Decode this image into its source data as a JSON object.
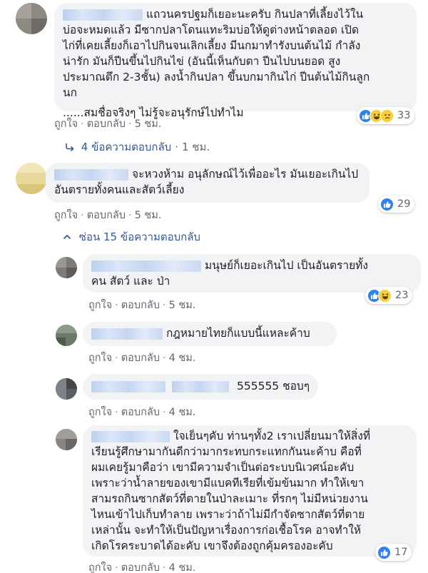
{
  "labels": {
    "like": "ถูกใจ",
    "reply": "ตอบกลับ",
    "dot": "·"
  },
  "comments": [
    {
      "author": "Jan Doe",
      "lines": [
        "แถวนครปฐมก็เยอะนะครับ กินปลาที่เลี้ยงไว้ใน",
        "บ่อจะหมดแล้ว มีซากปลาโดนแทะริมบ่อให้ดูต่างหน้าตลอด เปิด",
        "ไก่ที่เคยเลี้ยงก็เอาไปกินจนเลิกเลี้ยง มีนกมาทำรังบนต้นไม้ กำลัง",
        "น่ารัก มันก็ปีนขึ้นไปกินไข่ (อันนี้เห็นกับตา ปีนไปบนยอด สูง",
        "ประมาณตึก 2-3ชั้น) ลงน้ำกินปลา ขึ้นบกมากินไก่ ปีนต้นไม้กินลูก",
        "นก",
        "",
        "......สมชื่อจริงๆ ไม่รู้จะอนุรักษ์ไปทำไม"
      ],
      "reactions": {
        "icons": [
          "like",
          "haha",
          "sad"
        ],
        "count": "33"
      },
      "time": "5 ชม.",
      "replies": {
        "label": "4 ข้อความตอบกลับ",
        "time": "1 ชม."
      }
    },
    {
      "author": "Jan Doe",
      "lines": [
        "จะหวงห้าม อนุลักษณ์ไว้เพื่ออะไร มันเยอะเกินไป",
        "อันตรายทั้งคนและสัตว์เลี้ยง"
      ],
      "reactions": {
        "icons": [
          "like"
        ],
        "count": "29"
      },
      "time": "5 ชม.",
      "hide_replies": "ซ่อน 15 ข้อความตอบกลับ",
      "replies_list": [
        {
          "lines": [
            "มนุษย์ก็เยอะเกินไป เป็นอันตรายทั้ง",
            "คน สัตว์ และ ป่า"
          ],
          "reactions": {
            "icons": [
              "like",
              "haha"
            ],
            "count": "23"
          },
          "time": "5 ชม."
        },
        {
          "lines": [
            "กฎหมายไทยก็แบบนี้แหละค้าบ"
          ],
          "time": "4 ชม."
        },
        {
          "lines": [
            "555555 ชอบๆ"
          ],
          "time": "4 ชม."
        },
        {
          "lines": [
            "ใจเย็นๆคับ ท่านๆทั้ง2 เราเปลี่ยนมาให้สิ่งที่",
            "เรียนรู้ศึกษามากันดีกว่ามากระทบกระแทกกันนะค้าบ คือที่",
            "ผมเคยรู้มาคือว่า เขามีความจำเป็นต่อระบบนิเวศน์อะคับ",
            "เพราะว่าน้ำลายของเขามีแบคทีเรียที่เข้มข้นมาก ทำให้เขา",
            "สามรถกินซากสัตว์ที่ตายในป่าละเมาะ ที่รกๆ ไม่มีหน่วยงาน",
            "ไหนเข้าไปเก็บทำลาย เพราะว่าถ้าไม่มีกำจัดซากสัตว์ที่ตาย",
            "เหล่านั้น จะทำให้เป็นปัญหาเรื่องการก่อเชื้อโรค อาจทำให้",
            "เกิดโรคระบาดได้อะคับ เขาจึงต้องถูกคุ้มครองอะคับ"
          ],
          "reactions": {
            "icons": [
              "like"
            ],
            "count": "17"
          },
          "time": "4 ชม."
        }
      ]
    }
  ]
}
